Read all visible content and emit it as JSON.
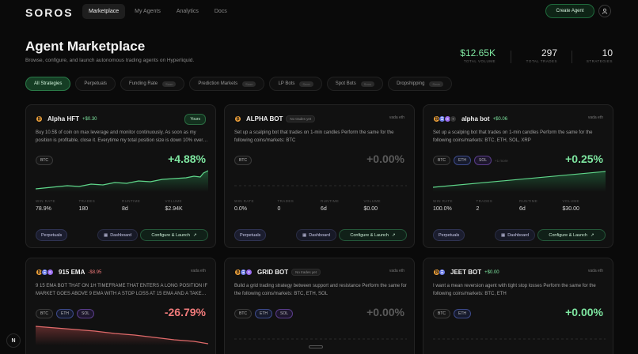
{
  "nav": {
    "logo": "SOROS",
    "links": [
      "Marketplace",
      "My Agents",
      "Analytics",
      "Docs"
    ],
    "create_label": "Create Agent"
  },
  "header": {
    "title": "Agent Marketplace",
    "subtitle": "Browse, configure, and launch autonomous trading agents on Hyperliquid.",
    "stats": [
      {
        "value": "$12.65K",
        "label": "TOTAL VOLUME"
      },
      {
        "value": "297",
        "label": "TOTAL TRADES"
      },
      {
        "value": "10",
        "label": "STRATEGIES"
      }
    ]
  },
  "filters": [
    {
      "label": "All Strategies",
      "count": ""
    },
    {
      "label": "Perpetuals",
      "count": ""
    },
    {
      "label": "Funding Rate",
      "count": "Soon"
    },
    {
      "label": "Prediction Markets",
      "count": "Soon"
    },
    {
      "label": "LP Bots",
      "count": "Soon"
    },
    {
      "label": "Spot Bots",
      "count": "Soon"
    },
    {
      "label": "Dropshipping",
      "count": "Soon"
    }
  ],
  "metric_labels": {
    "win": "WIN RATE",
    "trades": "TRADES",
    "runtime": "RUNTIME",
    "volume": "VOLUME"
  },
  "card_labels": {
    "market": "Perpetuals",
    "dashboard": "Dashboard",
    "configure": "Configure & Launch"
  },
  "cards": [
    {
      "name": "Alpha HFT",
      "pnl": "+$0.30",
      "badge": "Yours",
      "owner": "",
      "description": "Buy 10.5$ of coin on max leverage and monitor continuously. As soon as my position is profitable, close it. Everytime my total position size is down 10% over…",
      "coins": [
        "BTC"
      ],
      "more": "",
      "big_pnl": "+4.88%",
      "win_rate": "78.9%",
      "trades": "180",
      "runtime": "8d",
      "volume": "$2.94K"
    },
    {
      "name": "ALPHA BOT",
      "pnl": "",
      "badge": "No trades yet",
      "owner": "vada eth",
      "description": "Set up a scalping bot that trades on 1-min candles Perform the same for the following coins/markets: BTC",
      "coins": [
        "BTC"
      ],
      "more": "",
      "big_pnl": "+0.00%",
      "win_rate": "0.0%",
      "trades": "0",
      "runtime": "6d",
      "volume": "$0.00"
    },
    {
      "name": "alpha bot",
      "pnl": "+$0.06",
      "badge": "",
      "owner": "vada eth",
      "description": "Set up a scalping bot that trades on 1-min candles Perform the same for the following coins/markets: BTC, ETH, SOL, XRP",
      "coins": [
        "BTC",
        "ETH",
        "SOL"
      ],
      "more": "+1 more",
      "big_pnl": "+0.25%",
      "win_rate": "100.0%",
      "trades": "2",
      "runtime": "6d",
      "volume": "$30.00"
    },
    {
      "name": "915 EMA",
      "pnl": "-$8.95",
      "badge": "",
      "owner": "vada eth",
      "description": "9 15 EMA BOT THAT ON 1H TIMEFRAME THAT ENTERS A LONG POSITION IF MARKET GOES ABOVE 9 EMA WITH A STOP LOSS AT 15 EMA AND A TAKE…",
      "coins": [
        "BTC",
        "ETH",
        "SOL"
      ],
      "more": "",
      "big_pnl": "-26.79%"
    },
    {
      "name": "GRID BOT",
      "pnl": "",
      "badge": "No trades yet",
      "owner": "vada eth",
      "description": "Build a grid trading strategy between support and resistance Perform the same for the following coins/markets: BTC, ETH, SOL",
      "coins": [
        "BTC",
        "ETH",
        "SOL"
      ],
      "more": "",
      "big_pnl": "+0.00%"
    },
    {
      "name": "JEET BOT",
      "pnl": "+$0.00",
      "badge": "",
      "owner": "vada eth",
      "description": "I want a mean reversion agent with tight stop losses Perform the same for the following coins/markets: BTC, ETH",
      "coins": [
        "BTC",
        "ETH"
      ],
      "more": "",
      "big_pnl": "+0.00%"
    }
  ],
  "colors": {
    "accent": "#7ee6a0",
    "negative": "#f07a7a",
    "background": "#0a0a0a"
  }
}
